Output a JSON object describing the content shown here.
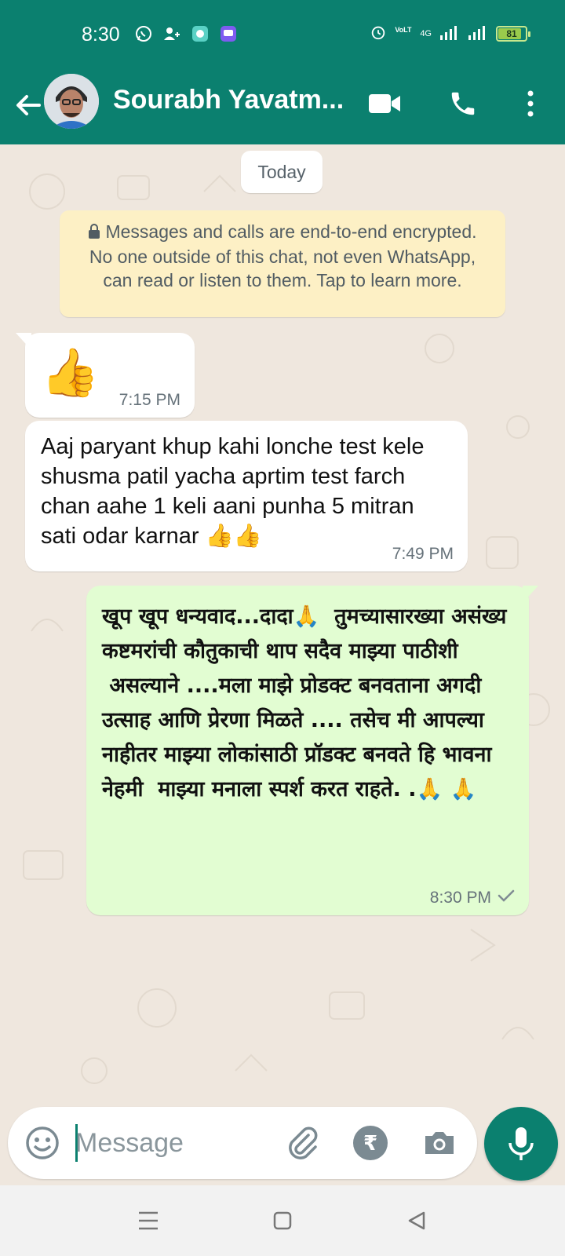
{
  "status_bar": {
    "time": "8:30",
    "battery": "81",
    "network": "4G",
    "carrier_tag": "VoLTE",
    "icons": [
      "whatsapp-icon",
      "add-contact-icon",
      "app-notification-icon",
      "messaging-icon",
      "alarm-icon",
      "volte-icon",
      "signal-icon",
      "battery-icon"
    ]
  },
  "header": {
    "contact_name": "Sourabh Yavatm...",
    "accent_color": "#0b806f",
    "icons": [
      "back-arrow-icon",
      "avatar",
      "video-call-icon",
      "voice-call-icon",
      "more-options-icon"
    ]
  },
  "chat": {
    "date_chip": "Today",
    "encryption_notice": "Messages and calls are end-to-end encrypted. No one outside of this chat, not even WhatsApp, can read or listen to them. Tap to learn more.",
    "messages": [
      {
        "direction": "incoming",
        "text": "👍",
        "time": "7:15 PM"
      },
      {
        "direction": "incoming",
        "text": "Aaj paryant khup kahi lonche test kele shusma patil yacha aprtim test farch chan aahe 1 keli aani punha 5 mitran sati odar karnar 👍👍",
        "time": "7:49 PM"
      },
      {
        "direction": "outgoing",
        "text": "खूप खूप धन्यवाद...दादा🙏  तुमच्यासारख्या असंख्य कष्टमरांची कौतुकाची थाप सदैव माझ्या पाठीशी\n असल्याने ....मला माझे प्रोडक्ट बनवताना अगदी उत्साह आणि प्रेरणा मिळते .... तसेच मी आपल्या नाहीतर माझ्या लोकांसाठी प्रॉडक्ट बनवते हि भावना नेहमी  माझ्या मनाला स्पर्श करत राहते. .🙏 🙏",
        "time": "8:30 PM",
        "status": "sent-check-icon"
      }
    ]
  },
  "composer": {
    "placeholder": "Message",
    "rupee_symbol": "₹",
    "icons": [
      "emoji-icon",
      "attach-icon",
      "payment-rupee-icon",
      "camera-icon",
      "mic-icon"
    ]
  },
  "nav_bar": {
    "icons": [
      "menu-icon",
      "home-icon",
      "back-icon"
    ]
  }
}
